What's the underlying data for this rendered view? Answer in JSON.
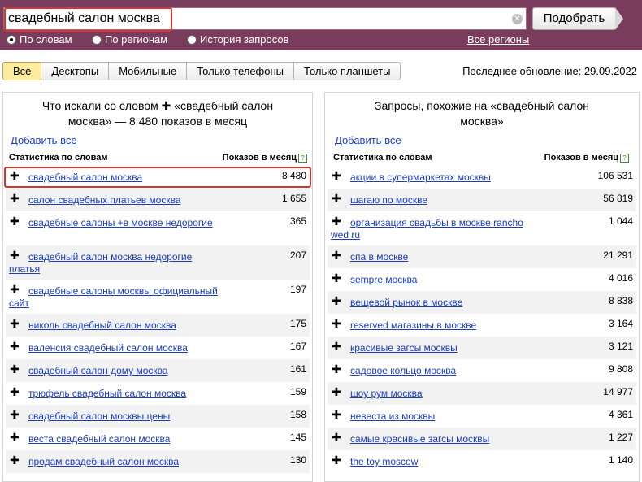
{
  "search": {
    "query": "свадебный салон москва",
    "button_label": "Подобрать",
    "radio_words": "По словам",
    "radio_regions": "По регионам",
    "radio_history": "История запросов",
    "all_regions_link": "Все регионы"
  },
  "tabs": [
    {
      "label": "Все"
    },
    {
      "label": "Десктопы"
    },
    {
      "label": "Мобильные"
    },
    {
      "label": "Только телефоны"
    },
    {
      "label": "Только планшеты"
    }
  ],
  "last_updated": "Последнее обновление: 29.09.2022",
  "left_panel": {
    "title_line1": "Что искали со словом ✚ «свадебный салон",
    "title_line2": "москва» — 8 480 показов в месяц",
    "add_all": "Добавить все",
    "col_phrase": "Статистика по словам",
    "col_count": "Показов в месяц",
    "rows": [
      {
        "phrase": "свадебный салон москва",
        "count": "8 480"
      },
      {
        "phrase": "салон свадебных платьев москва",
        "count": "1 655"
      },
      {
        "phrase": "свадебные салоны +в москве недорогие",
        "count": "365"
      },
      {
        "phrase": "свадебный салон москва недорогие платья",
        "count": "207"
      },
      {
        "phrase": "свадебные салоны москвы официальный сайт",
        "count": "197"
      },
      {
        "phrase": "николь свадебный салон москва",
        "count": "175"
      },
      {
        "phrase": "валенсия свадебный салон москва",
        "count": "167"
      },
      {
        "phrase": "свадебный салон дому москва",
        "count": "161"
      },
      {
        "phrase": "трюфель свадебный салон москва",
        "count": "159"
      },
      {
        "phrase": "свадебный салон москвы цены",
        "count": "158"
      },
      {
        "phrase": "веста свадебный салон москва",
        "count": "145"
      },
      {
        "phrase": "продам свадебный салон москва",
        "count": "130"
      }
    ]
  },
  "right_panel": {
    "title_line1": "Запросы, похожие на «свадебный салон",
    "title_line2": "москва»",
    "add_all": "Добавить все",
    "col_phrase": "Статистика по словам",
    "col_count": "Показов в месяц",
    "rows": [
      {
        "phrase": "акции в супермаркетах москвы",
        "count": "106 531"
      },
      {
        "phrase": "шагаю по москве",
        "count": "56 819"
      },
      {
        "phrase": "организация свадьбы в москве rancho wed ru",
        "count": "1 044"
      },
      {
        "phrase": "спа в москве",
        "count": "21 291"
      },
      {
        "phrase": "sempre москва",
        "count": "4 016"
      },
      {
        "phrase": "вещевой рынок в москве",
        "count": "8 838"
      },
      {
        "phrase": "reserved магазины в москве",
        "count": "3 164"
      },
      {
        "phrase": "красивые загсы москвы",
        "count": "3 121"
      },
      {
        "phrase": "садовое кольцо москва",
        "count": "9 808"
      },
      {
        "phrase": "шоу рум москва",
        "count": "14 977"
      },
      {
        "phrase": "невеста из москвы",
        "count": "4 361"
      },
      {
        "phrase": "самые красивые загсы москвы",
        "count": "1 227"
      },
      {
        "phrase": "the toy moscow",
        "count": "1 140"
      }
    ]
  },
  "colors": {
    "topbar": "#7a3c5c",
    "link": "#1a3dc1",
    "highlight": "#d9342b",
    "active_tab": "#ffeba0"
  }
}
